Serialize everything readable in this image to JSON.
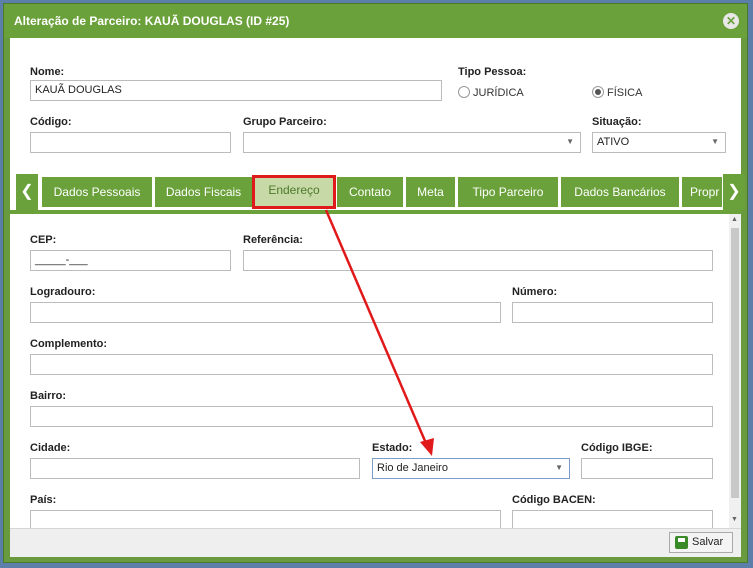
{
  "window": {
    "title": "Alteração de Parceiro: KAUÃ DOUGLAS (ID #25)"
  },
  "header": {
    "nome_label": "Nome:",
    "nome_value": "KAUÃ DOUGLAS",
    "tipo_pessoa_label": "Tipo Pessoa:",
    "tipo_juridica": "JURÍDICA",
    "tipo_fisica": "FÍSICA",
    "codigo_label": "Código:",
    "grupo_label": "Grupo Parceiro:",
    "situacao_label": "Situação:",
    "situacao_value": "ATIVO"
  },
  "tabs": [
    "Dados Pessoais",
    "Dados Fiscais",
    "Endereço",
    "Contato",
    "Meta",
    "Tipo Parceiro",
    "Dados Bancários",
    "Propr"
  ],
  "address": {
    "cep_label": "CEP:",
    "cep_value": "_____-___",
    "referencia_label": "Referência:",
    "logradouro_label": "Logradouro:",
    "numero_label": "Número:",
    "complemento_label": "Complemento:",
    "bairro_label": "Bairro:",
    "cidade_label": "Cidade:",
    "estado_label": "Estado:",
    "estado_value": "Rio de Janeiro",
    "ibge_label": "Código IBGE:",
    "pais_label": "País:",
    "bacen_label": "Código BACEN:"
  },
  "footer": {
    "save_label": "Salvar"
  },
  "colors": {
    "accent": "#6aa13a",
    "highlight": "#e0191b"
  }
}
